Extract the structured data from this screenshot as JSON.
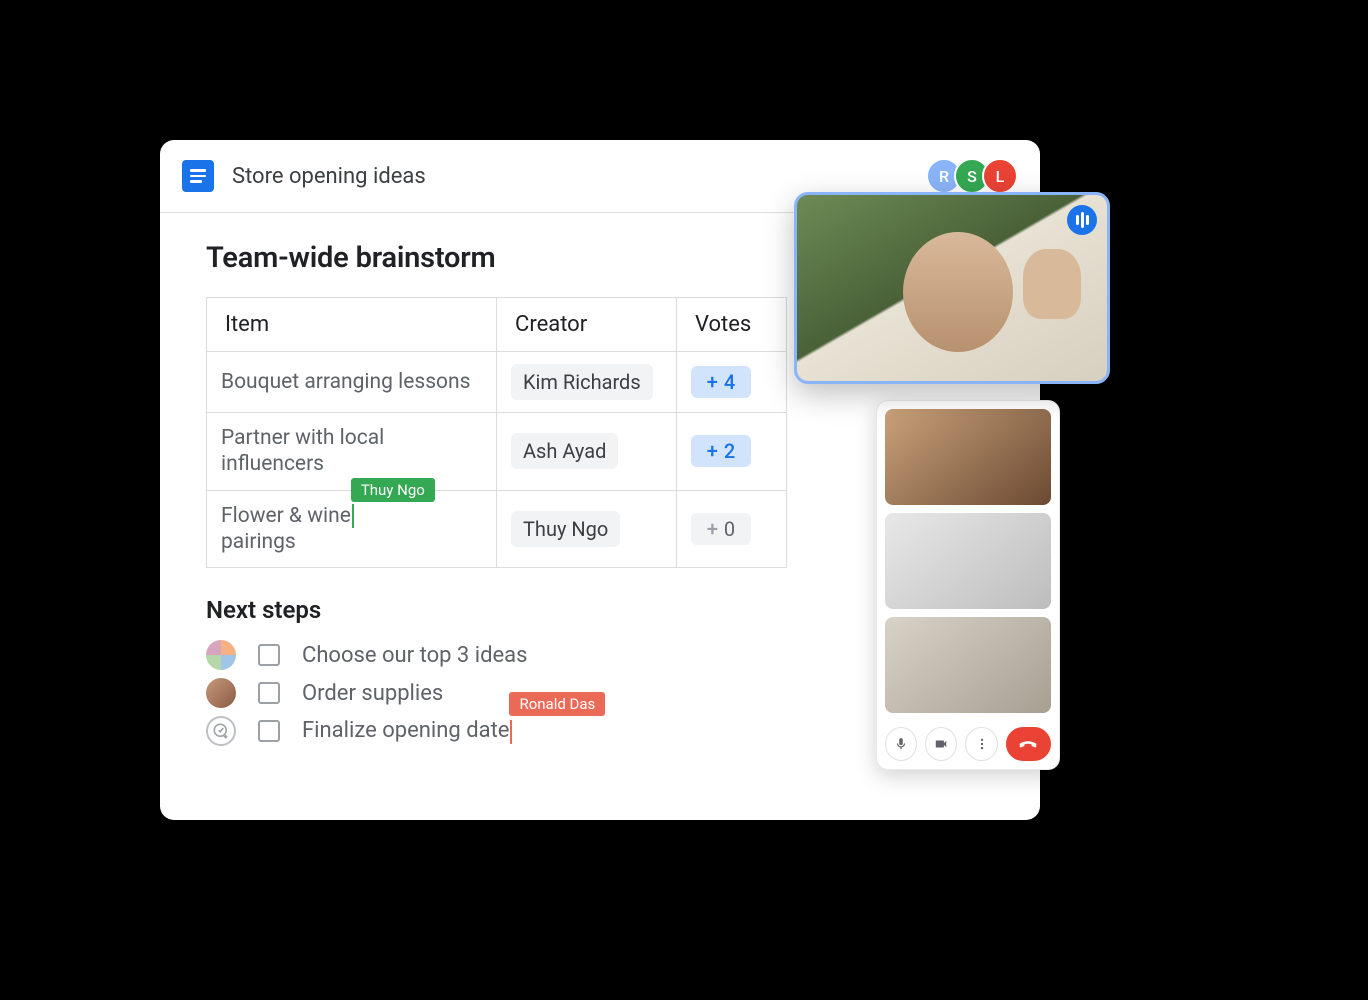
{
  "doc": {
    "title": "Store opening ideas"
  },
  "collaborators": [
    {
      "initial": "R",
      "color": "#8ab4f8"
    },
    {
      "initial": "S",
      "color": "#34a853"
    },
    {
      "initial": "L",
      "color": "#ea4335"
    }
  ],
  "heading": "Team-wide brainstorm",
  "table": {
    "columns": {
      "item": "Item",
      "creator": "Creator",
      "votes": "Votes"
    },
    "rows": [
      {
        "item": "Bouquet arranging lessons",
        "creator": "Kim Richards",
        "votes": 4,
        "active": true
      },
      {
        "item": "Partner with local influencers",
        "creator": "Ash Ayad",
        "votes": 2,
        "active": true
      },
      {
        "item_pre": "Flower & wine",
        "item_post": "pairings",
        "creator": "Thuy Ngo",
        "votes": 0,
        "active": false,
        "cursor_user": "Thuy Ngo"
      }
    ]
  },
  "next_steps": {
    "heading": "Next steps",
    "tasks": [
      {
        "text": "Choose our top 3 ideas"
      },
      {
        "text": "Order supplies"
      },
      {
        "text": "Finalize opening date",
        "cursor_user": "Ronald Das"
      }
    ]
  },
  "vote_plus": "+",
  "colors": {
    "accent": "#1a73e8",
    "cursor_green": "#34a853",
    "cursor_red": "#ea6a57",
    "hangup": "#ea4335"
  }
}
